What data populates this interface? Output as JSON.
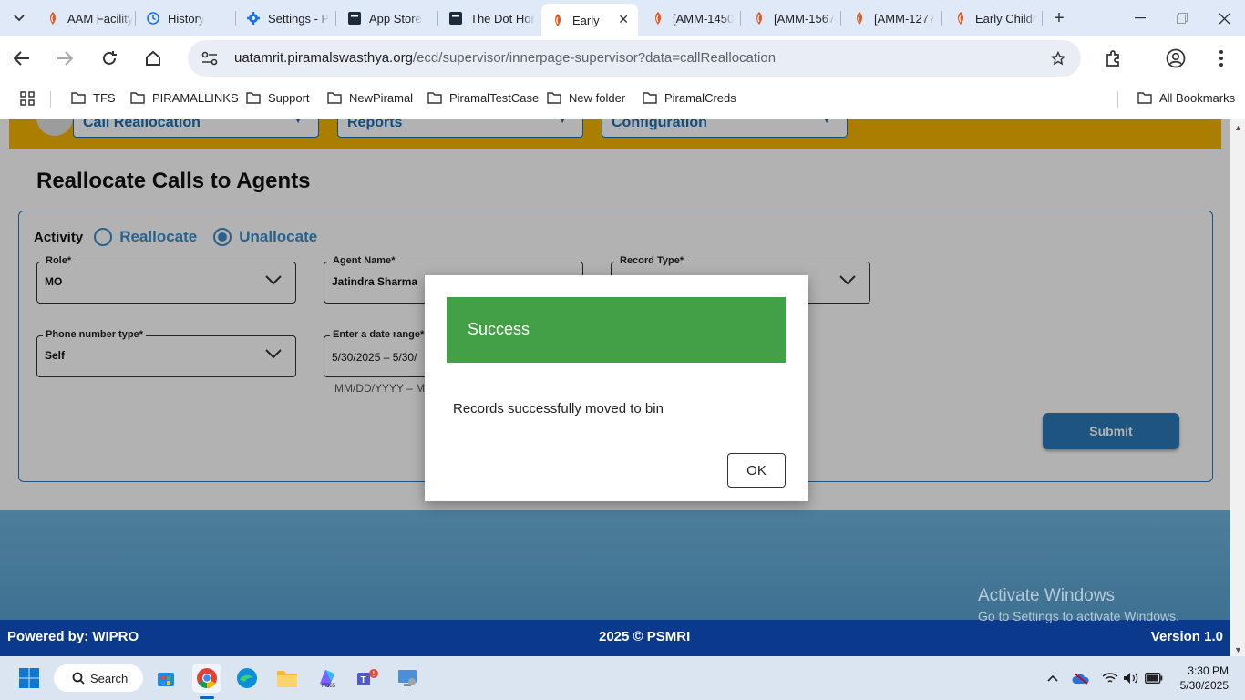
{
  "browser": {
    "tabs": [
      {
        "label": "AAM Facility",
        "icon": "piramal-favicon"
      },
      {
        "label": "History",
        "icon": "history-icon"
      },
      {
        "label": "Settings - P",
        "icon": "settings-gear-icon"
      },
      {
        "label": "App Store",
        "icon": "app-store-icon"
      },
      {
        "label": "The Dot Hor",
        "icon": "dot-icon"
      },
      {
        "label": "Early",
        "icon": "piramal-favicon"
      },
      {
        "label": "[AMM-1450",
        "icon": "piramal-favicon"
      },
      {
        "label": "[AMM-1567",
        "icon": "piramal-favicon"
      },
      {
        "label": "[AMM-1277",
        "icon": "piramal-favicon"
      },
      {
        "label": "Early Childh",
        "icon": "piramal-favicon"
      }
    ],
    "active_tab_index": 5,
    "url_host": "uatamrit.piramalswasthya.org",
    "url_path": "/ecd/supervisor/innerpage-supervisor?data=callReallocation",
    "bookmarks": [
      "TFS",
      "PIRAMALLINKS",
      "Support",
      "NewPiramal",
      "PiramalTestCase",
      "New folder",
      "PiramalCreds"
    ],
    "all_bookmarks": "All Bookmarks"
  },
  "app": {
    "menus": [
      "Call Reallocation",
      "Reports",
      "Configuration"
    ],
    "page_title": "Reallocate Calls to Agents",
    "activity_label": "Activity",
    "radio_options": [
      {
        "label": "Reallocate",
        "selected": false
      },
      {
        "label": "Unallocate",
        "selected": true
      }
    ],
    "fields": {
      "role": {
        "label": "Role",
        "value": "MO"
      },
      "agent": {
        "label": "Agent Name",
        "value": "Jatindra Sharma"
      },
      "record_type": {
        "label": "Record Type",
        "value": ""
      },
      "phone_type": {
        "label": "Phone number type",
        "value": "Self"
      },
      "date_range": {
        "label": "Enter a date range",
        "value": "5/30/2025 – 5/30/",
        "hint": "MM/DD/YYYY – M"
      }
    },
    "required_mark": "*",
    "submit_label": "Submit",
    "accent_color": "#2b7ab8",
    "header_color": "#f5b400"
  },
  "dialog": {
    "title": "Success",
    "message": "Records successfully moved to bin",
    "ok_label": "OK",
    "header_color": "#43a047"
  },
  "footer": {
    "left": "Powered by: WIPRO",
    "center": "2025 © PSMRI",
    "right": "Version 1.0"
  },
  "watermark": {
    "line1": "Activate Windows",
    "line2": "Go to Settings to activate Windows."
  },
  "taskbar": {
    "search_label": "Search",
    "time": "3:30 PM",
    "date": "5/30/2025"
  }
}
